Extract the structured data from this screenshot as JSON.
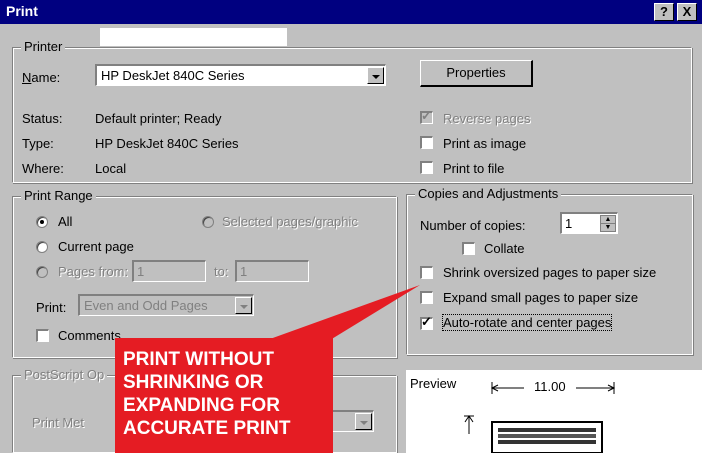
{
  "window": {
    "title": "Print",
    "help_label": "?",
    "close_label": "X"
  },
  "printer": {
    "group_label": "Printer",
    "name_label": "Name:",
    "name_value": "HP DeskJet 840C Series",
    "status_label": "Status:",
    "status_value": "Default printer; Ready",
    "type_label": "Type:",
    "type_value": "HP DeskJet 840C Series",
    "where_label": "Where:",
    "where_value": "Local",
    "properties_label": "Properties",
    "reverse_pages_label": "Reverse pages",
    "print_as_image_label": "Print as image",
    "print_to_file_label": "Print to file"
  },
  "print_range": {
    "group_label": "Print Range",
    "all_label": "All",
    "selected_label": "Selected pages/graphic",
    "current_page_label": "Current page",
    "pages_from_label": "Pages from:",
    "from_value": "1",
    "to_label": "to:",
    "to_value": "1",
    "print_label": "Print:",
    "print_value": "Even and Odd Pages",
    "comments_label": "Comments"
  },
  "copies": {
    "group_label": "Copies and Adjustments",
    "number_label": "Number of copies:",
    "number_value": "1",
    "collate_label": "Collate",
    "shrink_label": "Shrink oversized pages to paper size",
    "expand_label": "Expand small pages to paper size",
    "autorotate_label": "Auto-rotate and center pages"
  },
  "postscript": {
    "group_label": "PostScript Op",
    "method_label": "Print Met"
  },
  "preview": {
    "label": "Preview",
    "width_value": "11.00"
  },
  "callout": {
    "line1": "PRINT WITHOUT",
    "line2": "SHRINKING OR",
    "line3": "EXPANDING FOR",
    "line4": "ACCURATE PRINT"
  },
  "colors": {
    "title_bar": "#000080",
    "dialog_face": "#c0c0c0",
    "callout": "#e51c23"
  }
}
